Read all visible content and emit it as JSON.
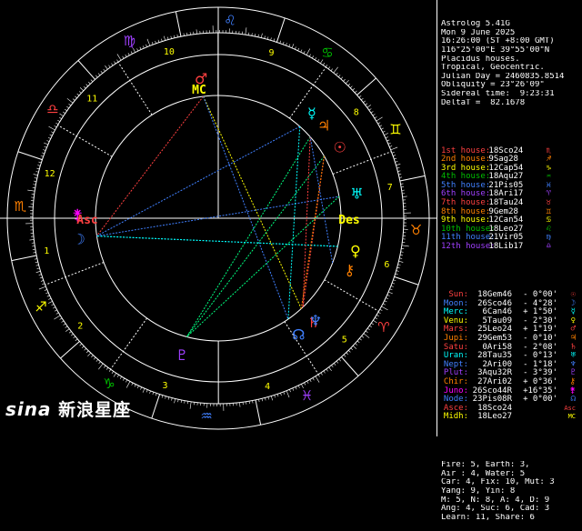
{
  "header": [
    "Astrolog 5.41G",
    "Mon 9 June 2025",
    "16:26:00 (ST +8:00 GMT)",
    "116°25'00\"E 39°55'00\"N",
    "Placidus houses.",
    "Tropical, Geocentric.",
    "Julian Day = 2460835.8514",
    "Obliquity = 23°26'09\"",
    "Sidereal time:  9:23:31",
    "DeltaT =  82.1678"
  ],
  "houses": [
    {
      "label": "1st house:",
      "value": "18Sco24",
      "sym": "♏",
      "color": "#ff4040"
    },
    {
      "label": "2nd house:",
      "value": "9Sag28",
      "sym": "♐",
      "color": "#ff8000"
    },
    {
      "label": "3rd house:",
      "value": "12Cap54",
      "sym": "♑",
      "color": "#ffff00"
    },
    {
      "label": "4th house:",
      "value": "18Aqu27",
      "sym": "♒",
      "color": "#00c000"
    },
    {
      "label": "5th house:",
      "value": "21Pis05",
      "sym": "♓",
      "color": "#4080ff"
    },
    {
      "label": "6th house:",
      "value": "18Ari17",
      "sym": "♈",
      "color": "#a040ff"
    },
    {
      "label": "7th house:",
      "value": "18Tau24",
      "sym": "♉",
      "color": "#ff4040"
    },
    {
      "label": "8th house:",
      "value": "9Gem28",
      "sym": "♊",
      "color": "#ff8000"
    },
    {
      "label": "9th house:",
      "value": "12Can54",
      "sym": "♋",
      "color": "#ffff00"
    },
    {
      "label": "10th house:",
      "value": "18Leo27",
      "sym": "♌",
      "color": "#00c000"
    },
    {
      "label": "11th house:",
      "value": "21Vir05",
      "sym": "♍",
      "color": "#4080ff"
    },
    {
      "label": "12th house:",
      "value": "18Lib17",
      "sym": "♎",
      "color": "#a040ff"
    }
  ],
  "planets": [
    {
      "label": "Sun:",
      "value": "18Gem46",
      "aspect": "- 0°00'",
      "sym": "☉",
      "color": "#ff4040"
    },
    {
      "label": "Moon:",
      "value": "26Sco46",
      "aspect": "- 4°28'",
      "sym": "☽",
      "color": "#4080ff"
    },
    {
      "label": "Merc:",
      "value": "6Can46",
      "aspect": "+ 1°50'",
      "sym": "☿",
      "color": "#00ffff"
    },
    {
      "label": "Venu:",
      "value": "5Tau09",
      "aspect": "- 2°30'",
      "sym": "♀",
      "color": "#ffff00"
    },
    {
      "label": "Mars:",
      "value": "25Leo24",
      "aspect": "+ 1°19'",
      "sym": "♂",
      "color": "#ff4040"
    },
    {
      "label": "Jupi:",
      "value": "29Gem53",
      "aspect": "- 0°10'",
      "sym": "♃",
      "color": "#ff8000"
    },
    {
      "label": "Satu:",
      "value": "0Ari58",
      "aspect": "- 2°08'",
      "sym": "♄",
      "color": "#ff4040"
    },
    {
      "label": "Uran:",
      "value": "28Tau35",
      "aspect": "- 0°13'",
      "sym": "♅",
      "color": "#00ffff"
    },
    {
      "label": "Nept:",
      "value": "2Ari00",
      "aspect": "- 1°18'",
      "sym": "♆",
      "color": "#4080ff"
    },
    {
      "label": "Plut:",
      "value": "3Aqu32R",
      "aspect": "- 3°39'",
      "sym": "♇",
      "color": "#a040ff"
    },
    {
      "label": "Chir:",
      "value": "27Ari02",
      "aspect": "+ 0°36'",
      "sym": "⚷",
      "color": "#ff8000"
    },
    {
      "label": "Juno:",
      "value": "26Sco44R",
      "aspect": "+16°35'",
      "sym": "⚵",
      "color": "#ff00ff"
    },
    {
      "label": "Node:",
      "value": "23Pis08R",
      "aspect": "+ 0°00'",
      "sym": "☊",
      "color": "#4080ff"
    },
    {
      "label": "Asce:",
      "value": "18Sco24",
      "aspect": "",
      "sym": "Asc",
      "color": "#ff4040"
    },
    {
      "label": "Midh:",
      "value": "18Leo27",
      "aspect": "",
      "sym": "MC",
      "color": "#ffff00"
    }
  ],
  "stats": [
    "Fire: 5, Earth: 3,",
    "Air : 4, Water: 5",
    "Car: 4, Fix: 10, Mut: 3",
    "Yang: 9, Yin: 8",
    "M: 5, N: 8, A: 4, D: 9",
    "Ang: 4, Suc: 6, Cad: 3",
    "Learn: 11, Share: 6"
  ],
  "wheel": {
    "signs": [
      "♈",
      "♉",
      "♊",
      "♋",
      "♌",
      "♍",
      "♎",
      "♏",
      "♐",
      "♑",
      "♒",
      "♓"
    ],
    "sign_colors": [
      "#ff4040",
      "#ff8000",
      "#ffff00",
      "#00c000",
      "#4080ff",
      "#a040ff",
      "#ff4040",
      "#ff8000",
      "#ffff00",
      "#00c000",
      "#4080ff",
      "#a040ff"
    ],
    "house_numbers": [
      "1",
      "2",
      "3",
      "4",
      "5",
      "6",
      "7",
      "8",
      "9",
      "10",
      "11",
      "12"
    ],
    "asc_label": "Asc",
    "des_label": "Des",
    "mc_label": "MC"
  },
  "logo": {
    "sina": "sina",
    "cn": "新浪星座"
  }
}
